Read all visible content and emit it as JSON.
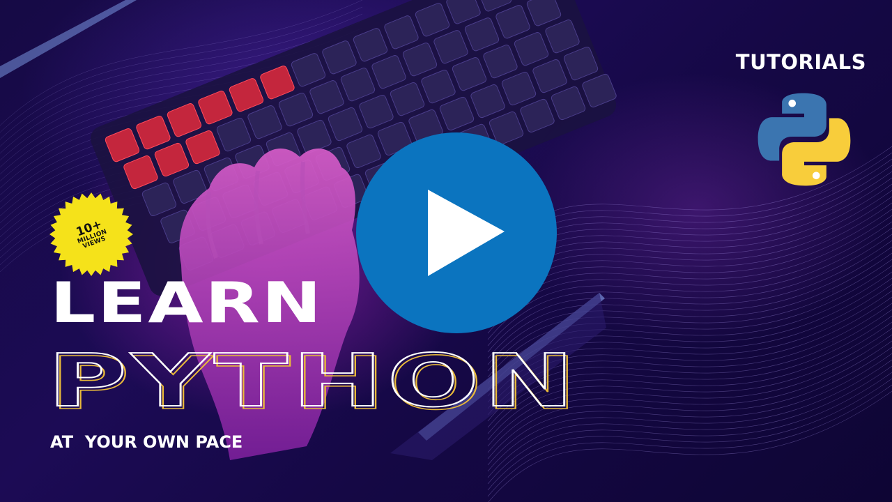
{
  "header": {
    "tutorials_label": "TUTORIALS",
    "logo_icon": "python-logo-icon"
  },
  "badge": {
    "count": "10+",
    "line2": "MILLION",
    "line3": "VIEWS",
    "color": "#f5e21a"
  },
  "player": {
    "play_icon": "play-icon",
    "accent": "#0b74bf"
  },
  "headline": {
    "line1": "LEARN",
    "line2": "PYTHON"
  },
  "subtitle": "AT  YOUR OWN PACE",
  "colors": {
    "python_blue": "#3b75b0",
    "python_yellow": "#f8cd3b",
    "outline_gold": "#e8b93a"
  }
}
